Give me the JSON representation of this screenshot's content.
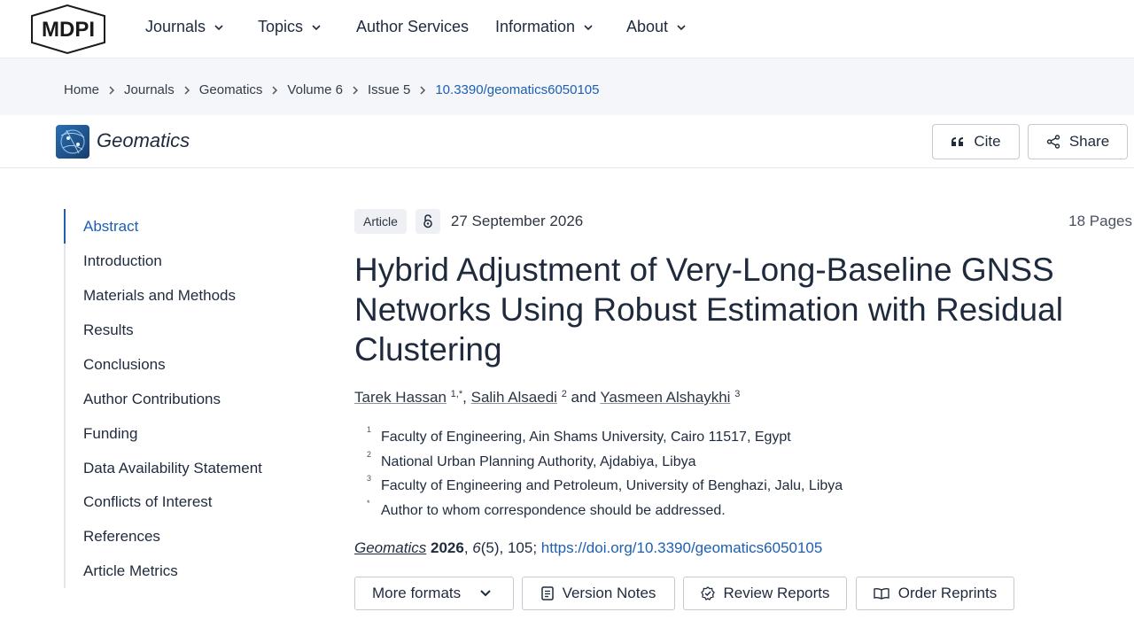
{
  "nav": {
    "logo_text": "MDPI",
    "items": [
      {
        "label": "Journals",
        "has_dropdown": true
      },
      {
        "label": "Topics",
        "has_dropdown": true
      },
      {
        "label": "Author Services",
        "has_dropdown": false
      },
      {
        "label": "Information",
        "has_dropdown": true
      },
      {
        "label": "About",
        "has_dropdown": true
      }
    ]
  },
  "breadcrumb": [
    "Home",
    "Journals",
    "Geomatics",
    "Volume 6",
    "Issue 5",
    "10.3390/geomatics6050105"
  ],
  "journal": {
    "name": "Geomatics",
    "cite_label": "Cite",
    "share_label": "Share"
  },
  "toc": {
    "active": "Abstract",
    "items": [
      "Abstract",
      "Introduction",
      "Materials and Methods",
      "Results",
      "Conclusions",
      "Author Contributions",
      "Funding",
      "Data Availability Statement",
      "Conflicts of Interest",
      "References",
      "Article Metrics"
    ]
  },
  "article": {
    "type": "Article",
    "open_access_icon": "open-access-icon",
    "date": "27 September 2026",
    "pages": "18 Pages",
    "title": "Hybrid Adjustment of Very-Long-Baseline GNSS Networks Using Robust Estimation with Residual Clustering",
    "authors": [
      {
        "name": "Tarek Hassan",
        "sup": "1,*"
      },
      {
        "name": "Salih Alsaedi",
        "sup": "2"
      },
      {
        "name": "Yasmeen Alshaykhi",
        "sup": "3"
      }
    ],
    "author_sep": ",",
    "author_and": "and",
    "affiliations": [
      {
        "mark": "1",
        "text": "Faculty of Engineering, Ain Shams University, Cairo 11517, Egypt"
      },
      {
        "mark": "2",
        "text": "National Urban Planning Authority, Ajdabiya, Libya"
      },
      {
        "mark": "3",
        "text": "Faculty of Engineering and Petroleum, University of Benghazi, Jalu, Libya"
      },
      {
        "mark": "*",
        "text": "Author to whom correspondence should be addressed."
      }
    ],
    "citation": {
      "journal": "Geomatics",
      "year": "2026",
      "volume": "6",
      "rest": "(5), 105;",
      "doi_url": "https://doi.org/10.3390/geomatics6050105"
    }
  },
  "actions": {
    "more_formats": "More formats",
    "version_notes": "Version Notes",
    "review_reports": "Review Reports",
    "order_reprints": "Order Reprints"
  },
  "colors": {
    "accent": "#1f5fb0",
    "text": "#1f2a3d",
    "breadcrumb_bg": "#f4f6f9"
  }
}
